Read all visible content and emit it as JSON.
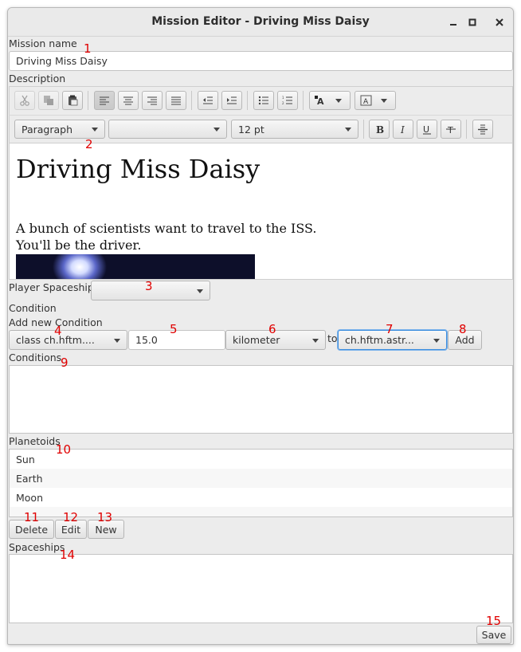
{
  "window": {
    "title": "Mission Editor - Driving Miss Daisy",
    "controls": [
      "minimize-icon",
      "maximize-icon",
      "close-icon"
    ]
  },
  "mission_name": {
    "label": "Mission name",
    "value": "Driving Miss Daisy"
  },
  "description": {
    "label": "Description",
    "format_combo": "Paragraph",
    "font_combo": "",
    "size_combo": "12 pt",
    "content": {
      "heading": "Driving Miss Daisy",
      "line1": "A bunch of scientists want to travel to the ISS.",
      "line2": "You'll be the driver."
    }
  },
  "player_spaceship": {
    "label": "Player Spaceship",
    "value": ""
  },
  "condition": {
    "label": "Condition",
    "add_label": "Add new Condition",
    "class_combo": "class ch.hftm....",
    "distance_value": "15.0",
    "unit_combo": "kilometer",
    "to_label": "to",
    "target_combo": "ch.hftm.astr...",
    "add_button": "Add"
  },
  "conditions": {
    "label": "Conditions",
    "items": []
  },
  "planetoids": {
    "label": "Planetoids",
    "items": [
      "Sun",
      "Earth",
      "Moon"
    ],
    "delete_button": "Delete",
    "edit_button": "Edit",
    "new_button": "New"
  },
  "spaceships": {
    "label": "Spaceships",
    "items": []
  },
  "save_button": "Save",
  "annotations": [
    "1",
    "2",
    "3",
    "4",
    "5",
    "6",
    "7",
    "8",
    "9",
    "10",
    "11",
    "12",
    "13",
    "14",
    "15"
  ],
  "colors": {
    "annotation": "#e00000",
    "focus": "#3c8dde"
  }
}
